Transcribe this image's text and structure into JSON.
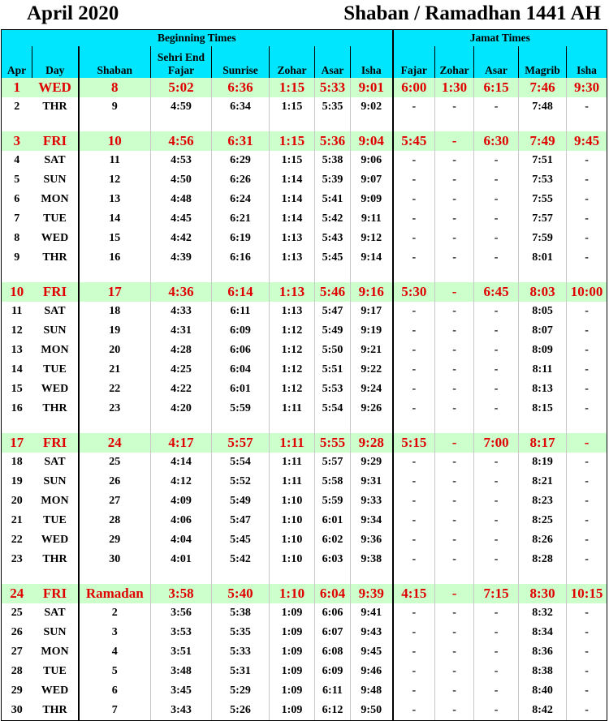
{
  "title": {
    "left": "April 2020",
    "right": "Shaban /  Ramadhan 1441 AH"
  },
  "headers": {
    "beginning": "Beginning Times",
    "jamat": "Jamat Times",
    "sehri": "Sehri End",
    "cols": [
      "Apr",
      "Day",
      "Shaban",
      "Fajar",
      "Sunrise",
      "Zohar",
      "Asar",
      "Isha",
      "Fajar",
      "Zohar",
      "Asar",
      "Magrib",
      "Isha"
    ]
  },
  "rows": [
    {
      "hl": true,
      "c": [
        "1",
        "WED",
        "8",
        "5:02",
        "6:36",
        "1:15",
        "5:33",
        "9:01",
        "6:00",
        "1:30",
        "6:15",
        "7:46",
        "9:30"
      ]
    },
    {
      "c": [
        "2",
        "THR",
        "9",
        "4:59",
        "6:34",
        "1:15",
        "5:35",
        "9:02",
        "-",
        "-",
        "-",
        "7:48",
        "-"
      ]
    },
    {
      "gap": true
    },
    {
      "hl": true,
      "c": [
        "3",
        "FRI",
        "10",
        "4:56",
        "6:31",
        "1:15",
        "5:36",
        "9:04",
        "5:45",
        "-",
        "6:30",
        "7:49",
        "9:45"
      ]
    },
    {
      "c": [
        "4",
        "SAT",
        "11",
        "4:53",
        "6:29",
        "1:15",
        "5:38",
        "9:06",
        "-",
        "-",
        "-",
        "7:51",
        "-"
      ]
    },
    {
      "c": [
        "5",
        "SUN",
        "12",
        "4:50",
        "6:26",
        "1:14",
        "5:39",
        "9:07",
        "-",
        "-",
        "-",
        "7:53",
        "-"
      ]
    },
    {
      "c": [
        "6",
        "MON",
        "13",
        "4:48",
        "6:24",
        "1:14",
        "5:41",
        "9:09",
        "-",
        "-",
        "-",
        "7:55",
        "-"
      ]
    },
    {
      "c": [
        "7",
        "TUE",
        "14",
        "4:45",
        "6:21",
        "1:14",
        "5:42",
        "9:11",
        "-",
        "-",
        "-",
        "7:57",
        "-"
      ]
    },
    {
      "c": [
        "8",
        "WED",
        "15",
        "4:42",
        "6:19",
        "1:13",
        "5:43",
        "9:12",
        "-",
        "-",
        "-",
        "7:59",
        "-"
      ]
    },
    {
      "c": [
        "9",
        "THR",
        "16",
        "4:39",
        "6:16",
        "1:13",
        "5:45",
        "9:14",
        "-",
        "-",
        "-",
        "8:01",
        "-"
      ]
    },
    {
      "gap": true
    },
    {
      "hl": true,
      "c": [
        "10",
        "FRI",
        "17",
        "4:36",
        "6:14",
        "1:13",
        "5:46",
        "9:16",
        "5:30",
        "-",
        "6:45",
        "8:03",
        "10:00"
      ]
    },
    {
      "c": [
        "11",
        "SAT",
        "18",
        "4:33",
        "6:11",
        "1:13",
        "5:47",
        "9:17",
        "-",
        "-",
        "-",
        "8:05",
        "-"
      ]
    },
    {
      "c": [
        "12",
        "SUN",
        "19",
        "4:31",
        "6:09",
        "1:12",
        "5:49",
        "9:19",
        "-",
        "-",
        "-",
        "8:07",
        "-"
      ]
    },
    {
      "c": [
        "13",
        "MON",
        "20",
        "4:28",
        "6:06",
        "1:12",
        "5:50",
        "9:21",
        "-",
        "-",
        "-",
        "8:09",
        "-"
      ]
    },
    {
      "c": [
        "14",
        "TUE",
        "21",
        "4:25",
        "6:04",
        "1:12",
        "5:51",
        "9:22",
        "-",
        "-",
        "-",
        "8:11",
        "-"
      ]
    },
    {
      "c": [
        "15",
        "WED",
        "22",
        "4:22",
        "6:01",
        "1:12",
        "5:53",
        "9:24",
        "-",
        "-",
        "-",
        "8:13",
        "-"
      ]
    },
    {
      "c": [
        "16",
        "THR",
        "23",
        "4:20",
        "5:59",
        "1:11",
        "5:54",
        "9:26",
        "-",
        "-",
        "-",
        "8:15",
        "-"
      ]
    },
    {
      "gap": true
    },
    {
      "hl": true,
      "c": [
        "17",
        "FRI",
        "24",
        "4:17",
        "5:57",
        "1:11",
        "5:55",
        "9:28",
        "5:15",
        "-",
        "7:00",
        "8:17",
        "-"
      ]
    },
    {
      "c": [
        "18",
        "SAT",
        "25",
        "4:14",
        "5:54",
        "1:11",
        "5:57",
        "9:29",
        "-",
        "-",
        "-",
        "8:19",
        "-"
      ]
    },
    {
      "c": [
        "19",
        "SUN",
        "26",
        "4:12",
        "5:52",
        "1:11",
        "5:58",
        "9:31",
        "-",
        "-",
        "-",
        "8:21",
        "-"
      ]
    },
    {
      "c": [
        "20",
        "MON",
        "27",
        "4:09",
        "5:49",
        "1:10",
        "5:59",
        "9:33",
        "-",
        "-",
        "-",
        "8:23",
        "-"
      ]
    },
    {
      "c": [
        "21",
        "TUE",
        "28",
        "4:06",
        "5:47",
        "1:10",
        "6:01",
        "9:34",
        "-",
        "-",
        "-",
        "8:25",
        "-"
      ]
    },
    {
      "c": [
        "22",
        "WED",
        "29",
        "4:04",
        "5:45",
        "1:10",
        "6:02",
        "9:36",
        "-",
        "-",
        "-",
        "8:26",
        "-"
      ]
    },
    {
      "c": [
        "23",
        "THR",
        "30",
        "4:01",
        "5:42",
        "1:10",
        "6:03",
        "9:38",
        "-",
        "-",
        "-",
        "8:28",
        "-"
      ]
    },
    {
      "gap": true
    },
    {
      "hl": true,
      "c": [
        "24",
        "FRI",
        "Ramadan",
        "3:58",
        "5:40",
        "1:10",
        "6:04",
        "9:39",
        "4:15",
        "-",
        "7:15",
        "8:30",
        "10:15"
      ]
    },
    {
      "c": [
        "25",
        "SAT",
        "2",
        "3:56",
        "5:38",
        "1:09",
        "6:06",
        "9:41",
        "-",
        "-",
        "-",
        "8:32",
        "-"
      ]
    },
    {
      "c": [
        "26",
        "SUN",
        "3",
        "3:53",
        "5:35",
        "1:09",
        "6:07",
        "9:43",
        "-",
        "-",
        "-",
        "8:34",
        "-"
      ]
    },
    {
      "c": [
        "27",
        "MON",
        "4",
        "3:51",
        "5:33",
        "1:09",
        "6:08",
        "9:45",
        "-",
        "-",
        "-",
        "8:36",
        "-"
      ]
    },
    {
      "c": [
        "28",
        "TUE",
        "5",
        "3:48",
        "5:31",
        "1:09",
        "6:09",
        "9:46",
        "-",
        "-",
        "-",
        "8:38",
        "-"
      ]
    },
    {
      "c": [
        "29",
        "WED",
        "6",
        "3:45",
        "5:29",
        "1:09",
        "6:11",
        "9:48",
        "-",
        "-",
        "-",
        "8:40",
        "-"
      ]
    },
    {
      "c": [
        "30",
        "THR",
        "7",
        "3:43",
        "5:26",
        "1:09",
        "6:12",
        "9:50",
        "-",
        "-",
        "-",
        "8:42",
        "-"
      ]
    }
  ],
  "colors": {
    "header_bg": "#00e6ff",
    "highlight_bg": "#ccffcc",
    "highlight_text": "#e00000"
  }
}
